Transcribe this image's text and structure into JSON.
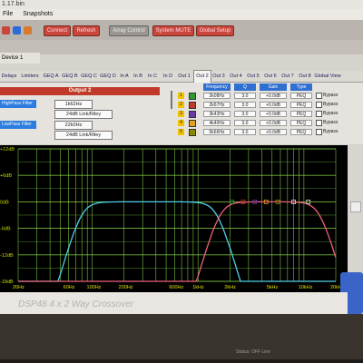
{
  "window": {
    "title": "1.17.bin"
  },
  "menu": [
    "File",
    "Snapshots"
  ],
  "toolbar": {
    "buttons": [
      {
        "label": "Connect"
      },
      {
        "label": "Refresh"
      },
      {
        "label": "Array Control"
      },
      {
        "label": "System MUTE"
      },
      {
        "label": "Global Setup"
      }
    ]
  },
  "device_tab": "Device 1",
  "tabs": [
    "Delays",
    "Limiters",
    "GEQ A",
    "GEQ B",
    "GEQ C",
    "GEQ D",
    "In A",
    "In B",
    "In C",
    "In D",
    "Out 1",
    "Out 2",
    "Out 3",
    "Out 4",
    "Out 5",
    "Out 6",
    "Out 7",
    "Out 8",
    "Global View"
  ],
  "active_tab": "Out 2",
  "output": {
    "header": "Output 2",
    "highpass": {
      "label": "HighPass Filter",
      "freq": "1k62Hz",
      "type": "24dB Link/Riley"
    },
    "lowpass": {
      "label": "LowPass Filter",
      "freq": "22k0Hz",
      "type": "24dB Link/Riley"
    }
  },
  "peq": {
    "headers": [
      "Frequency",
      "Q",
      "Gain",
      "Type"
    ],
    "bypass_label": "Bypass",
    "rows": [
      {
        "num": "1",
        "color": "#2e9b2e",
        "freq": "2k08Hz",
        "q": "3.0",
        "gain": "+0.0dB",
        "type": "PEQ"
      },
      {
        "num": "2",
        "color": "#c0392b",
        "freq": "2k67Hz",
        "q": "3.0",
        "gain": "+0.0dB",
        "type": "PEQ"
      },
      {
        "num": "3",
        "color": "#6b3aa0",
        "freq": "3k43Hz",
        "q": "3.0",
        "gain": "+0.0dB",
        "type": "PEQ"
      },
      {
        "num": "4",
        "color": "#e0a020",
        "freq": "4k40Hz",
        "q": "3.0",
        "gain": "+0.0dB",
        "type": "PEQ"
      },
      {
        "num": "5",
        "color": "#8a8a00",
        "freq": "5k66Hz",
        "q": "3.0",
        "gain": "+0.0dB",
        "type": "PEQ"
      }
    ]
  },
  "graph": {
    "y_ticks": [
      "+12dB",
      "+6dB",
      "0dB",
      "-6dB",
      "-12dB",
      "-18dB"
    ],
    "x_ticks": [
      "20Hz",
      "60Hz",
      "100Hz",
      "200Hz",
      "600Hz",
      "1kHz",
      "2kHz",
      "5kHz",
      "10kHz",
      "20kHz"
    ],
    "colors": {
      "grid": "#8ee04a",
      "curve_low": "#4fd0e8",
      "curve_high": "#f0607a"
    }
  },
  "brand": "DSP48 4 x 2 Way Crossover",
  "status": "Status: OFF Line"
}
